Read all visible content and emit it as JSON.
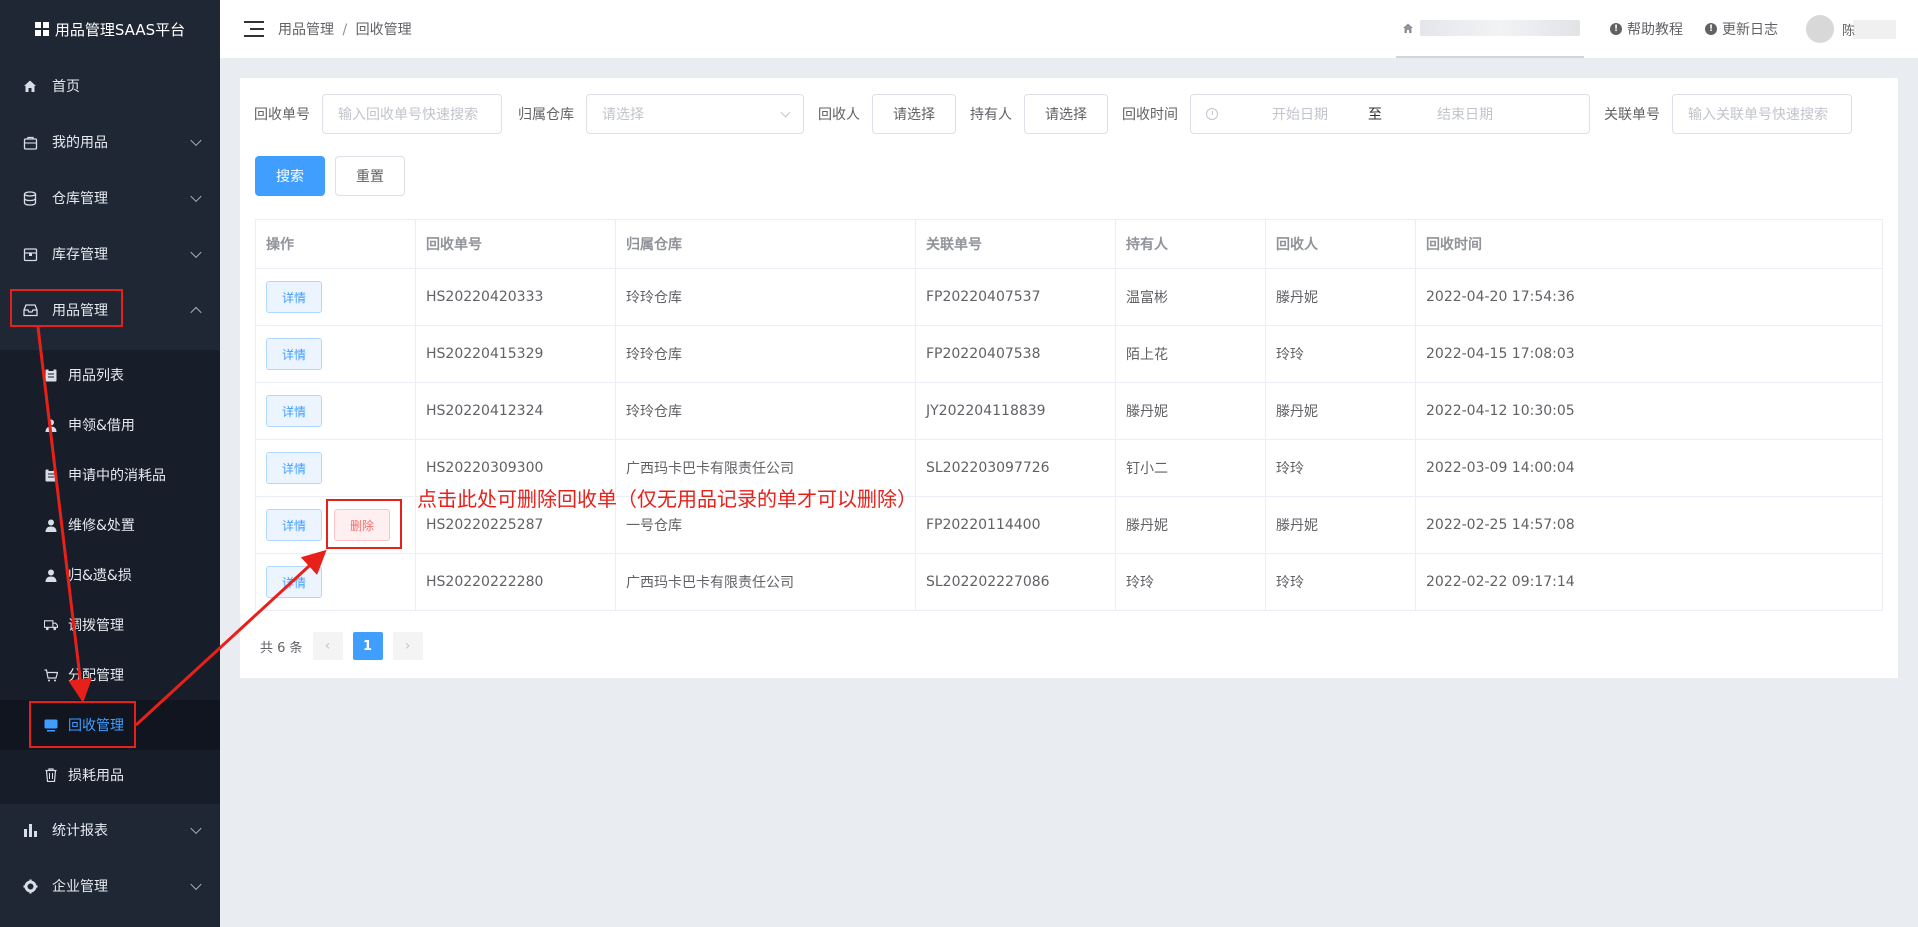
{
  "app": {
    "title": "用品管理SAAS平台"
  },
  "sidebar": {
    "items": [
      {
        "label": "首页",
        "icon": "home-icon",
        "has_children": false
      },
      {
        "label": "我的用品",
        "icon": "bag-icon",
        "has_children": true
      },
      {
        "label": "仓库管理",
        "icon": "database-icon",
        "has_children": true
      },
      {
        "label": "库存管理",
        "icon": "box-icon",
        "has_children": true
      },
      {
        "label": "用品管理",
        "icon": "inbox-icon",
        "has_children": true,
        "expanded": true
      },
      {
        "label": "统计报表",
        "icon": "bar-chart-icon",
        "has_children": true
      },
      {
        "label": "企业管理",
        "icon": "gear-icon",
        "has_children": true
      }
    ],
    "sub_items": [
      {
        "label": "用品列表",
        "icon": "clipboard-icon"
      },
      {
        "label": "申领&借用",
        "icon": "user-icon"
      },
      {
        "label": "申请中的消耗品",
        "icon": "clipboard-icon"
      },
      {
        "label": "维修&处置",
        "icon": "user-icon"
      },
      {
        "label": "归&遗&损",
        "icon": "user-icon"
      },
      {
        "label": "调拨管理",
        "icon": "truck-icon"
      },
      {
        "label": "分配管理",
        "icon": "cart-icon"
      },
      {
        "label": "回收管理",
        "icon": "monitor-icon",
        "active": true
      },
      {
        "label": "损耗用品",
        "icon": "trash-icon"
      }
    ]
  },
  "header": {
    "breadcrumb": [
      "用品管理",
      "回收管理"
    ],
    "breadcrumb_sep": "/",
    "help": "帮助教程",
    "changelog": "更新日志",
    "user_initial": "陈"
  },
  "filters": {
    "recycle_no_label": "回收单号",
    "recycle_no_placeholder": "输入回收单号快速搜索",
    "warehouse_label": "归属仓库",
    "warehouse_placeholder": "请选择",
    "recycler_label": "回收人",
    "recycler_btn": "请选择",
    "holder_label": "持有人",
    "holder_btn": "请选择",
    "time_label": "回收时间",
    "start_placeholder": "开始日期",
    "range_sep": "至",
    "end_placeholder": "结束日期",
    "related_label": "关联单号",
    "related_placeholder": "输入关联单号快速搜索",
    "search_btn": "搜索",
    "reset_btn": "重置"
  },
  "table": {
    "columns": [
      "操作",
      "回收单号",
      "归属仓库",
      "关联单号",
      "持有人",
      "回收人",
      "回收时间"
    ],
    "detail_label": "详情",
    "delete_label": "删除",
    "rows": [
      {
        "no": "HS20220420333",
        "warehouse": "玲玲仓库",
        "related": "FP20220407537",
        "holder": "温富彬",
        "recycler": "滕丹妮",
        "time": "2022-04-20 17:54:36",
        "deletable": false
      },
      {
        "no": "HS20220415329",
        "warehouse": "玲玲仓库",
        "related": "FP20220407538",
        "holder": "陌上花",
        "recycler": "玲玲",
        "time": "2022-04-15 17:08:03",
        "deletable": false
      },
      {
        "no": "HS20220412324",
        "warehouse": "玲玲仓库",
        "related": "JY202204118839",
        "holder": "滕丹妮",
        "recycler": "滕丹妮",
        "time": "2022-04-12 10:30:05",
        "deletable": false
      },
      {
        "no": "HS20220309300",
        "warehouse": "广西玛卡巴卡有限责任公司",
        "related": "SL202203097726",
        "holder": "钉小二",
        "recycler": "玲玲",
        "time": "2022-03-09 14:00:04",
        "deletable": false
      },
      {
        "no": "HS20220225287",
        "warehouse": "一号仓库",
        "related": "FP20220114400",
        "holder": "滕丹妮",
        "recycler": "滕丹妮",
        "time": "2022-02-25 14:57:08",
        "deletable": true
      },
      {
        "no": "HS20220222280",
        "warehouse": "广西玛卡巴卡有限责任公司",
        "related": "SL202202227086",
        "holder": "玲玲",
        "recycler": "玲玲",
        "time": "2022-02-22 09:17:14",
        "deletable": false
      }
    ]
  },
  "pagination": {
    "total_text": "共 6 条",
    "current_page": "1",
    "prev": "‹",
    "next": "›"
  },
  "annotation": {
    "text": "点击此处可删除回收单（仅无用品记录的单才可以删除）",
    "color": "#e8201a"
  },
  "colors": {
    "primary": "#409eff",
    "sidebar_bg": "#1f2634",
    "danger": "#f56c6c"
  }
}
